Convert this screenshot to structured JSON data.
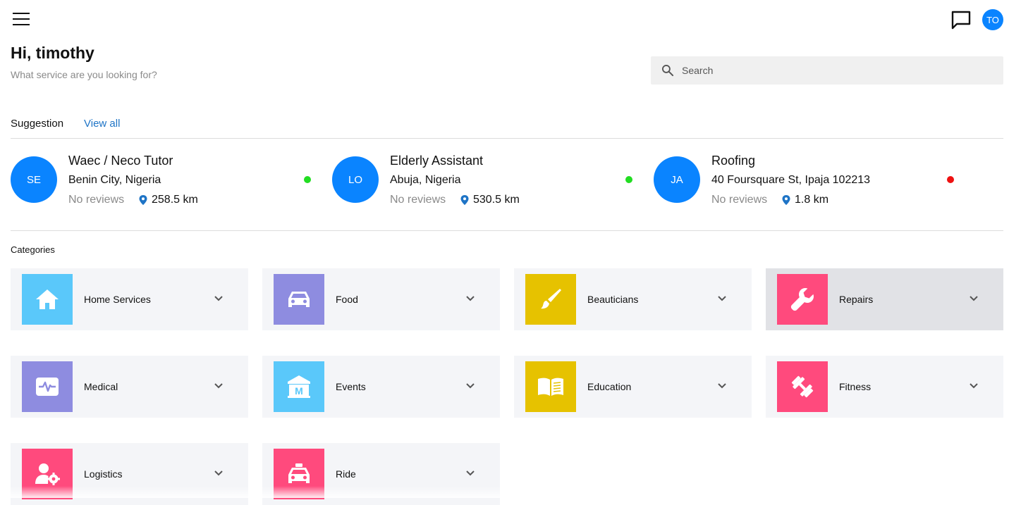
{
  "header": {
    "menu_icon": "hamburger-menu-icon",
    "chat_icon": "chat-bubble-icon",
    "avatar_initials": "TO",
    "accent": "#0a84ff"
  },
  "greeting": {
    "title": "Hi, timothy",
    "subtitle": "What service are you looking for?"
  },
  "search": {
    "placeholder": "Search",
    "icon": "search-icon"
  },
  "suggestions": {
    "heading": "Suggestion",
    "view_all": "View all",
    "items": [
      {
        "initials": "SE",
        "title": "Waec / Neco Tutor",
        "location": "Benin City, Nigeria",
        "reviews": "No reviews",
        "distance": "258.5 km",
        "status_color": "#22dd22"
      },
      {
        "initials": "LO",
        "title": "Elderly Assistant",
        "location": "Abuja, Nigeria",
        "reviews": "No reviews",
        "distance": "530.5 km",
        "status_color": "#22dd22"
      },
      {
        "initials": "JA",
        "title": "Roofing",
        "location": "40 Foursquare St, Ipaja 102213",
        "reviews": "No reviews",
        "distance": "1.8 km",
        "status_color": "#ee1111"
      }
    ]
  },
  "categories": {
    "heading": "Categories",
    "items": [
      {
        "label": "Home Services",
        "icon": "home-icon",
        "color": "#5ac8fa"
      },
      {
        "label": "Food",
        "icon": "car-icon",
        "color": "#8e8ce0"
      },
      {
        "label": "Beauticians",
        "icon": "paintbrush-icon",
        "color": "#e6c200"
      },
      {
        "label": "Repairs",
        "icon": "wrench-icon",
        "color": "#ff4a7d"
      },
      {
        "label": "Medical",
        "icon": "heartbeat-monitor-icon",
        "color": "#8e8ce0"
      },
      {
        "label": "Events",
        "icon": "building-m-icon",
        "color": "#5ac8fa"
      },
      {
        "label": "Education",
        "icon": "open-book-icon",
        "color": "#e6c200"
      },
      {
        "label": "Fitness",
        "icon": "dumbbell-icon",
        "color": "#ff4a7d"
      },
      {
        "label": "Logistics",
        "icon": "user-gear-icon",
        "color": "#ff4a7d"
      },
      {
        "label": "Ride",
        "icon": "taxi-icon",
        "color": "#ff4a7d"
      }
    ]
  }
}
